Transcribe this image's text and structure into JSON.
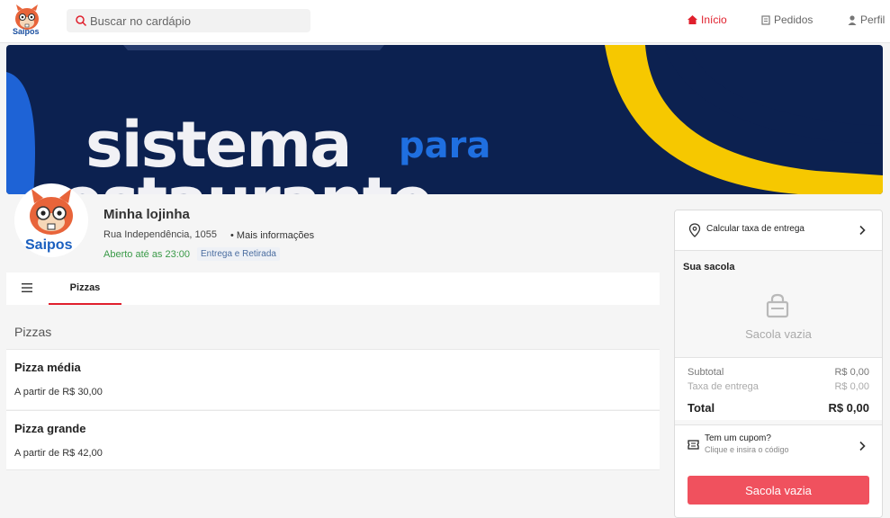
{
  "header": {
    "logo_text": "Saipos",
    "search_placeholder": "Buscar no cardápio",
    "nav": [
      {
        "label": "Início",
        "icon": "home-icon",
        "active": true
      },
      {
        "label": "Pedidos",
        "icon": "receipt-icon",
        "active": false
      },
      {
        "label": "Perfil",
        "icon": "user-icon",
        "active": false
      }
    ]
  },
  "banner": {
    "line1": "sistema",
    "word_para": "para",
    "line2": "restaurante"
  },
  "store": {
    "avatar_text": "Saipos",
    "name": "Minha lojinha",
    "address": "Rua Independência, 1055",
    "more_info": "• Mais informações",
    "open_status": "Aberto até as 23:00",
    "service_badge": "Entrega e Retirada"
  },
  "categories": {
    "tabs": [
      {
        "label": "Pizzas",
        "active": true
      }
    ]
  },
  "menu": {
    "section_title": "Pizzas",
    "products": [
      {
        "name": "Pizza média",
        "price": "A partir de R$ 30,00"
      },
      {
        "name": "Pizza grande",
        "price": "A partir de R$ 42,00"
      }
    ]
  },
  "bag": {
    "calc_delivery": "Calcular taxa de entrega",
    "title": "Sua sacola",
    "empty_text": "Sacola vazia",
    "subtotal_label": "Subtotal",
    "subtotal_value": "R$ 0,00",
    "fee_label": "Taxa de entrega",
    "fee_value": "R$ 0,00",
    "total_label": "Total",
    "total_value": "R$ 0,00",
    "coupon_title": "Tem um cupom?",
    "coupon_sub": "Clique e insira o código",
    "button_label": "Sacola vazia"
  },
  "colors": {
    "brand_red": "#e0202d",
    "button_red": "#f0515e",
    "banner_navy": "#0c2150",
    "banner_yellow": "#f6c800",
    "open_green": "#3a9a48"
  }
}
